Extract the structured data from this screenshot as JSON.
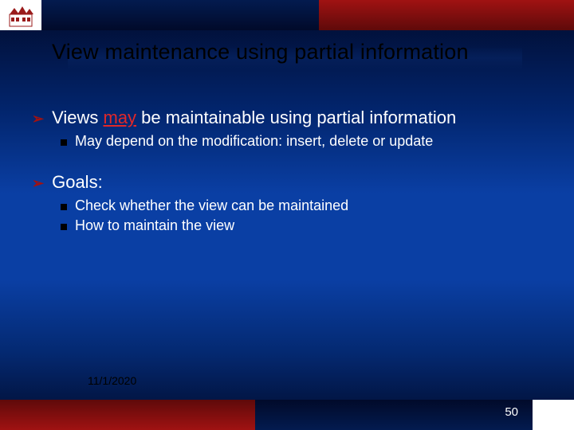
{
  "title": "View maintenance using partial information",
  "bullets": [
    {
      "pre": "Views ",
      "emph": "may",
      "post": " be maintainable using partial information",
      "sub": [
        "May depend on the modification: insert, delete or update"
      ]
    },
    {
      "text": "Goals:",
      "sub": [
        "Check whether the view can be maintained",
        "How to maintain the view"
      ]
    }
  ],
  "date": "11/1/2020",
  "page": "50"
}
